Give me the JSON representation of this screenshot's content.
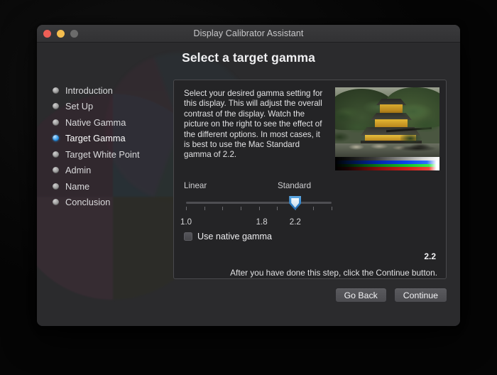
{
  "window": {
    "title": "Display Calibrator Assistant",
    "traffic_lights": [
      {
        "name": "close",
        "color": "#ee5f56"
      },
      {
        "name": "minimize",
        "color": "#f4bd4e"
      },
      {
        "name": "zoom",
        "color": "#6b6b6b"
      }
    ]
  },
  "heading": "Select a target gamma",
  "sidebar": {
    "items": [
      {
        "label": "Introduction",
        "active": false
      },
      {
        "label": "Set Up",
        "active": false
      },
      {
        "label": "Native Gamma",
        "active": false
      },
      {
        "label": "Target Gamma",
        "active": true
      },
      {
        "label": "Target White Point",
        "active": false
      },
      {
        "label": "Admin",
        "active": false
      },
      {
        "label": "Name",
        "active": false
      },
      {
        "label": "Conclusion",
        "active": false
      }
    ],
    "active_dot_color": "#2f97e8",
    "inactive_dot_color": "#8d8d8d"
  },
  "panel": {
    "description": "Select your desired gamma setting for this display. This will adjust the overall contrast of the display. Watch the picture on the right to see the effect of the different options. In most cases, it is best to use the Mac Standard gamma of 2.2.",
    "preview": {
      "name": "gamma-preview-image",
      "subject": "Golden pavilion temple with trees and pond",
      "color_bars": [
        "grayscale",
        "blue",
        "green",
        "red"
      ]
    },
    "slider": {
      "name": "target-gamma-slider",
      "left_label": "Linear",
      "right_label": "Standard",
      "tick_labels": [
        {
          "text": "1.0",
          "pct": 0
        },
        {
          "text": "1.8",
          "pct": 52
        },
        {
          "text": "2.2",
          "pct": 75
        }
      ],
      "tick_count": 9,
      "value": 2.2,
      "min": 1.0,
      "max": 2.6,
      "thumb_pct": 75,
      "thumb_color": "#2f82c9"
    },
    "native_gamma": {
      "label": "Use native gamma",
      "checked": false
    },
    "value_readout": "2.2",
    "hint": "After you have done this step, click the Continue button."
  },
  "footer": {
    "go_back_label": "Go Back",
    "continue_label": "Continue"
  }
}
